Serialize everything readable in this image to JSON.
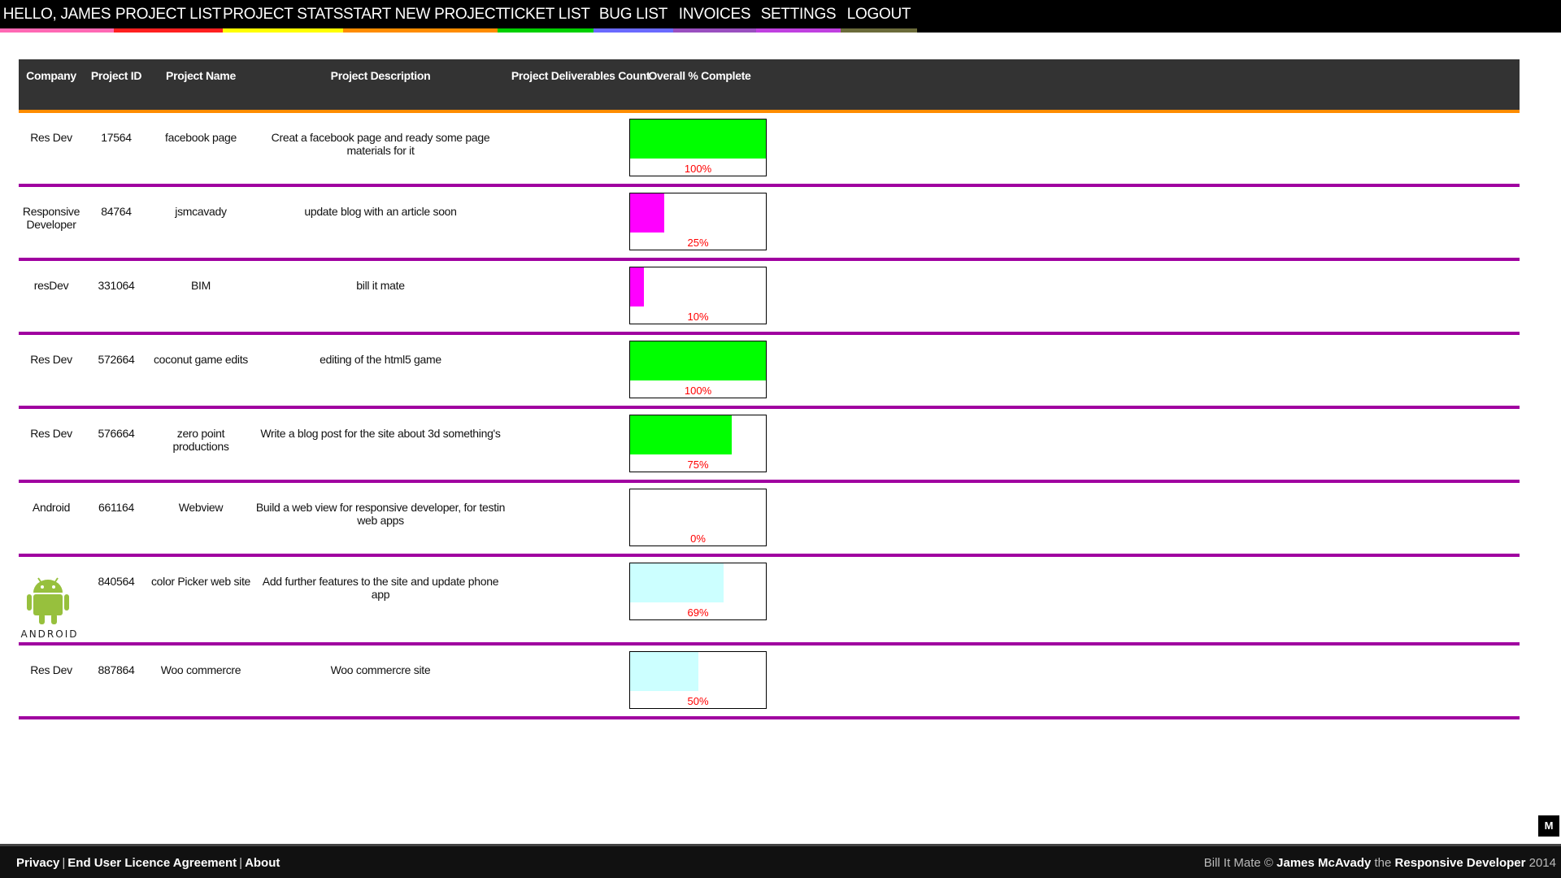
{
  "nav": {
    "items": [
      {
        "label": "HELLO, JAMES",
        "color": "#ff69b4"
      },
      {
        "label": "PROJECT LIST",
        "color": "#ff2020"
      },
      {
        "label": "PROJECT STATS",
        "color": "#ffff00"
      },
      {
        "label": "START NEW PROJECT",
        "color": "#ff8c00"
      },
      {
        "label": "TICKET LIST",
        "color": "#00d000"
      },
      {
        "label": "BUG LIST",
        "color": "#6a6aff"
      },
      {
        "label": "INVOICES",
        "color": "#9a4fc0"
      },
      {
        "label": "SETTINGS",
        "color": "#c040e0"
      },
      {
        "label": "LOGOUT",
        "color": "#6b6b3a"
      }
    ]
  },
  "table": {
    "headers": {
      "company": "Company",
      "project_id": "Project ID",
      "project_name": "Project Name",
      "project_description": "Project Description",
      "deliverables_count": "Project Deliverables Count",
      "overall_complete": "Overall % Complete"
    },
    "rows": [
      {
        "company": "Res Dev",
        "project_id": "17564",
        "project_name": "facebook page",
        "description": "Creat a facebook page and ready some page materials for it",
        "deliverables": "",
        "percent_label": "100%",
        "percent": 100,
        "bar_color": "#00ff00"
      },
      {
        "company": "Responsive Developer",
        "project_id": "84764",
        "project_name": "jsmcavady",
        "description": "update blog with an article soon",
        "deliverables": "",
        "percent_label": "25%",
        "percent": 25,
        "bar_color": "#ff00ff"
      },
      {
        "company": "resDev",
        "project_id": "331064",
        "project_name": "BIM",
        "description": "bill it mate",
        "deliverables": "",
        "percent_label": "10%",
        "percent": 10,
        "bar_color": "#ff00ff"
      },
      {
        "company": "Res Dev",
        "project_id": "572664",
        "project_name": "coconut game edits",
        "description": "editing of the html5 game",
        "deliverables": "",
        "percent_label": "100%",
        "percent": 100,
        "bar_color": "#00ff00"
      },
      {
        "company": "Res Dev",
        "project_id": "576664",
        "project_name": "zero point productions",
        "description": "Write a blog post for the site about 3d something's",
        "deliverables": "",
        "percent_label": "75%",
        "percent": 75,
        "bar_color": "#00ff00"
      },
      {
        "company": "Android",
        "project_id": "661164",
        "project_name": "Webview",
        "description": "Build a web view for responsive developer, for testin web apps",
        "deliverables": "",
        "percent_label": "0%",
        "percent": 0,
        "bar_color": "#00ff00"
      },
      {
        "company": "",
        "company_logo": "android",
        "logo_text": "ANDROID",
        "project_id": "840564",
        "project_name": "color Picker web site",
        "description": "Add further features to the site and update phone app",
        "deliverables": "",
        "percent_label": "69%",
        "percent": 69,
        "bar_color": "#ccffff"
      },
      {
        "company": "Res Dev",
        "project_id": "887864",
        "project_name": "Woo commercre",
        "description": "Woo commercre site",
        "deliverables": "",
        "percent_label": "50%",
        "percent": 50,
        "bar_color": "#ccffff"
      }
    ]
  },
  "footer": {
    "links": [
      "Privacy",
      "End User Licence Agreement",
      "About"
    ],
    "separator": "|",
    "app_name": "Bill It Mate ©",
    "author": "James McAvady",
    "the": "the",
    "company": "Responsive Developer",
    "year": "2014"
  },
  "m_button": "M",
  "icons": {
    "android": "android-robot-logo"
  }
}
